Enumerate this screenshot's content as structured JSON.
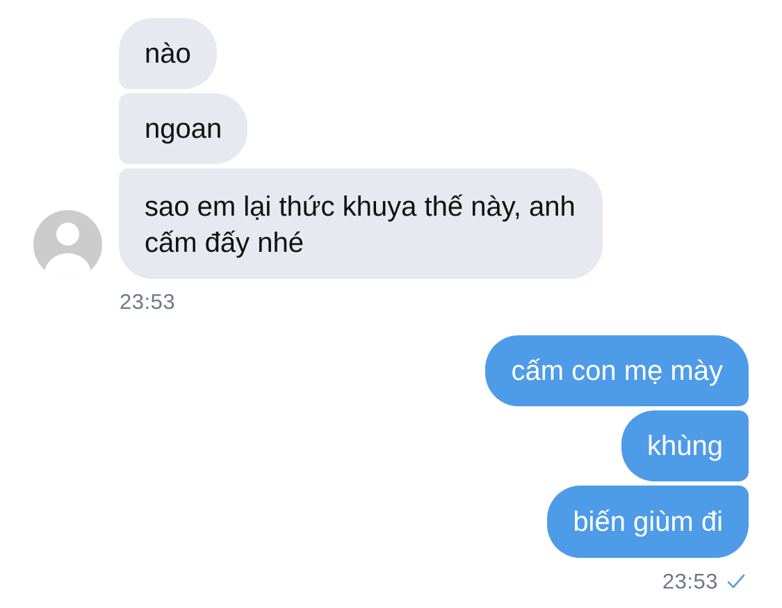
{
  "conversation": {
    "incoming": {
      "messages": [
        "nào",
        "ngoan",
        "sao em lại thức khuya thế này, anh cấm đấy nhé"
      ],
      "timestamp": "23:53",
      "avatar_icon": "default-user-avatar-icon"
    },
    "outgoing": {
      "messages": [
        "cấm con mẹ mày",
        "khùng",
        "biến giùm đi"
      ],
      "timestamp": "23:53",
      "status_icon": "read-check-icon"
    }
  },
  "colors": {
    "incoming_bubble": "#e6e9f0",
    "outgoing_bubble": "#4e9be8",
    "timestamp": "#6e7886",
    "check": "#4e9be8"
  }
}
